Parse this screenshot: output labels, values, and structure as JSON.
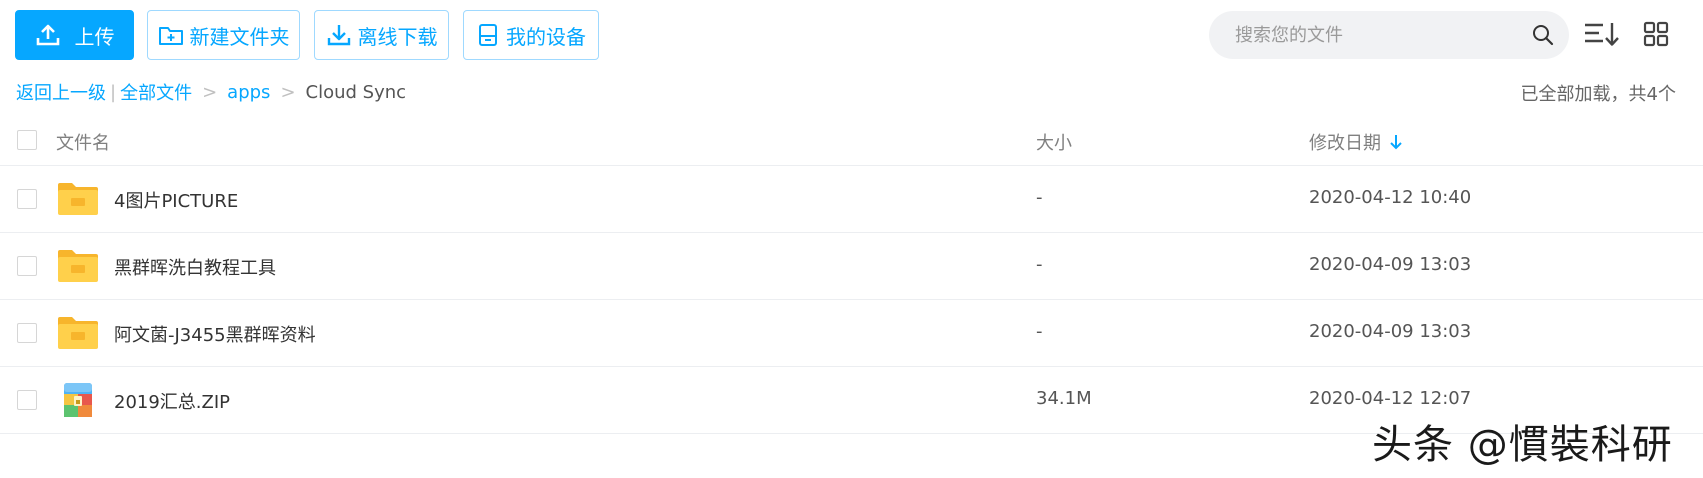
{
  "toolbar": {
    "upload_label": "上传",
    "new_folder_label": "新建文件夹",
    "offline_download_label": "离线下载",
    "my_devices_label": "我的设备",
    "search_placeholder": "搜索您的文件",
    "sort_icon": "sort-list-icon",
    "grid_icon": "grid-view-icon"
  },
  "breadcrumb": {
    "back": "返回上一级",
    "separator_bar": "|",
    "all_files": "全部文件",
    "apps": "apps",
    "current": "Cloud Sync",
    "separator": ">"
  },
  "load_status": "已全部加载，共4个",
  "table": {
    "columns": {
      "name": "文件名",
      "size": "大小",
      "modified": "修改日期"
    },
    "sort_indicator": "arrow-down-icon",
    "rows": [
      {
        "name": "4图片PICTURE",
        "size": "-",
        "date": "2020-04-12 10:40",
        "icon": "folder-icon"
      },
      {
        "name": "黑群晖洗白教程工具",
        "size": "-",
        "date": "2020-04-09 13:03",
        "icon": "folder-icon"
      },
      {
        "name": "阿文菌-J3455黑群晖资料",
        "size": "-",
        "date": "2020-04-09 13:03",
        "icon": "folder-icon"
      },
      {
        "name": "2019汇总.ZIP",
        "size": "34.1M",
        "date": "2020-04-12 12:07",
        "icon": "zip-file-icon"
      }
    ]
  },
  "watermark": "头条 @慣裝科研",
  "colors": {
    "accent": "#06a7ff",
    "folder": "#ffd04b",
    "folder_dark": "#f7b52c"
  }
}
